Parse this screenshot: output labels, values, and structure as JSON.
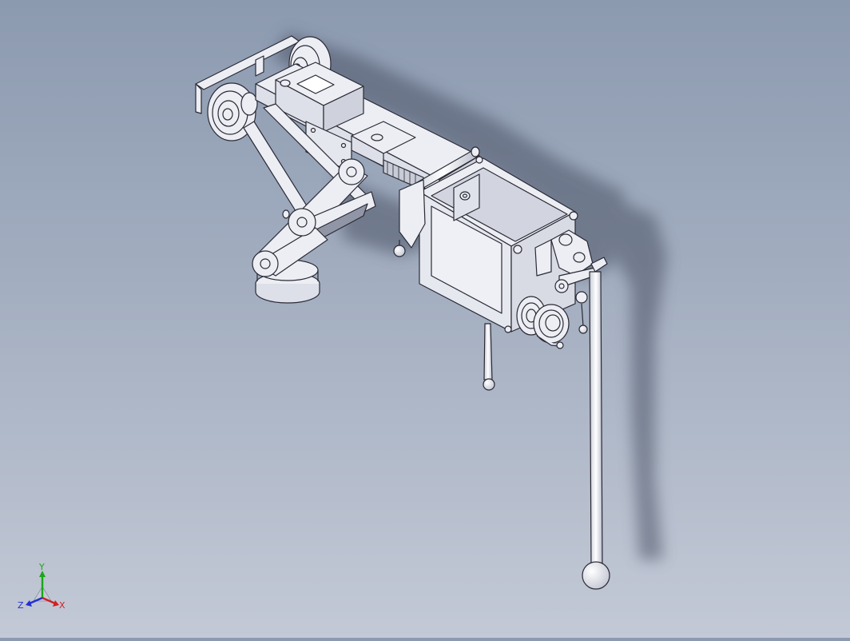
{
  "viewport": {
    "background_top": "#8c9ab0",
    "background_bottom": "#c3c9d6",
    "part_fill": "#eceef4",
    "part_stroke": "#2a2a35",
    "shadow_color": "#4b5366"
  },
  "triad": {
    "x_label": "X",
    "y_label": "Y",
    "z_label": "Z",
    "x_color": "#d42020",
    "y_color": "#18a818",
    "z_color": "#2030d0"
  }
}
